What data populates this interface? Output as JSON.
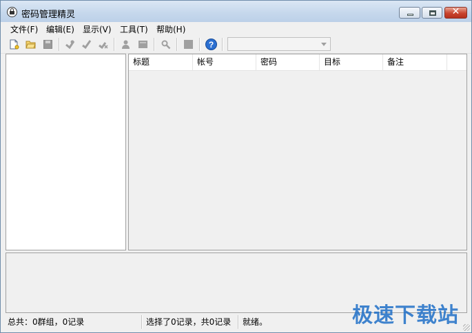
{
  "window": {
    "title": "密码管理精灵",
    "controls": {
      "minimize": "minimize",
      "maximize": "maximize",
      "close": "✕"
    }
  },
  "menubar": {
    "items": [
      {
        "label": "文件(F)"
      },
      {
        "label": "编辑(E)"
      },
      {
        "label": "显示(V)"
      },
      {
        "label": "工具(T)"
      },
      {
        "label": "帮助(H)"
      }
    ]
  },
  "toolbar": {
    "buttons": [
      {
        "icon": "new-file-icon",
        "enabled": true
      },
      {
        "icon": "open-folder-icon",
        "enabled": true
      },
      {
        "icon": "save-icon",
        "enabled": false
      },
      {
        "icon": "add-record-icon",
        "enabled": false
      },
      {
        "icon": "edit-record-icon",
        "enabled": false
      },
      {
        "icon": "delete-record-icon",
        "enabled": false
      },
      {
        "icon": "user-icon",
        "enabled": false
      },
      {
        "icon": "group-icon",
        "enabled": false
      },
      {
        "icon": "search-icon",
        "enabled": false
      },
      {
        "icon": "stop-icon",
        "enabled": false
      },
      {
        "icon": "help-icon",
        "enabled": true
      }
    ],
    "combo_value": ""
  },
  "table": {
    "columns": [
      "标题",
      "帐号",
      "密码",
      "目标",
      "备注"
    ],
    "rows": []
  },
  "statusbar": {
    "summary": "总共：0群组，0记录",
    "selection": "选择了0记录，共0记录",
    "state": "就绪。"
  },
  "watermark": "极速下载站",
  "colors": {
    "accent": "#1f6fc7",
    "close_button": "#c9442e",
    "help_icon": "#2b6fd1"
  }
}
